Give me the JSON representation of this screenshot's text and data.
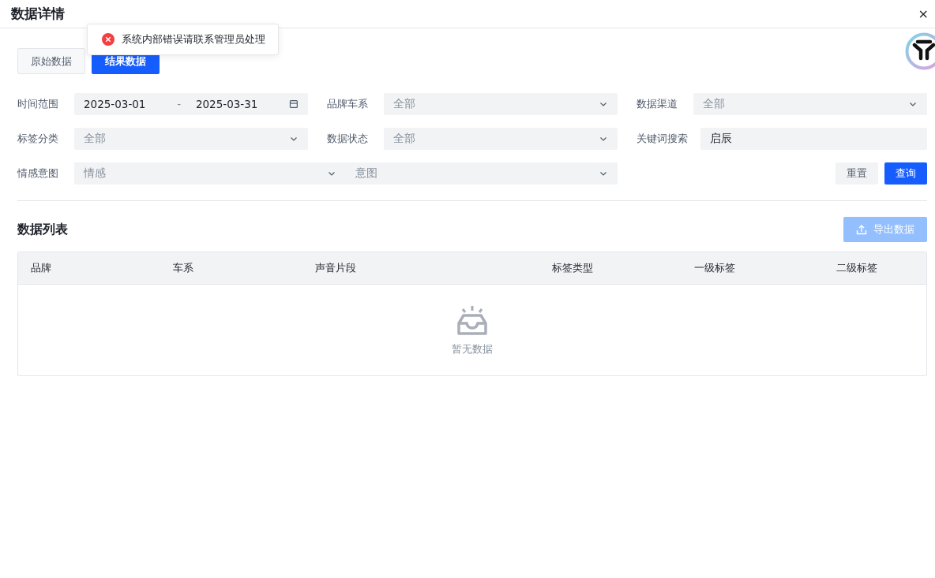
{
  "dialog": {
    "title": "数据详情",
    "close": "×"
  },
  "toast": {
    "kind": "error",
    "message": "系统内部错误请联系管理员处理"
  },
  "tabs": [
    {
      "label": "原始数据",
      "selected": false
    },
    {
      "label": "结果数据",
      "selected": true
    }
  ],
  "filters": [
    {
      "kind": "daterange",
      "label": "时间范围",
      "start": "2025-03-01",
      "separator": "-",
      "end": "2025-03-31"
    },
    {
      "kind": "select",
      "label": "品牌车系",
      "placeholder": "全部"
    },
    {
      "kind": "select",
      "label": "数据渠道",
      "placeholder": "全部"
    },
    {
      "kind": "select",
      "label": "标签分类",
      "placeholder": "全部"
    },
    {
      "kind": "select",
      "label": "数据状态",
      "placeholder": "全部"
    },
    {
      "kind": "text",
      "label": "关键词搜索",
      "value": "启辰"
    },
    {
      "kind": "dual-select",
      "label": "情感意图",
      "options": [
        {
          "placeholder": "情感"
        },
        {
          "placeholder": "意图"
        }
      ]
    }
  ],
  "actions": [
    {
      "label": "重置",
      "kind": "secondary"
    },
    {
      "label": "查询",
      "kind": "primary"
    }
  ],
  "list": {
    "title": "数据列表",
    "export": {
      "label": "导出数据",
      "disabled": true
    },
    "columns": [
      "品牌",
      "车系",
      "声音片段",
      "标签类型",
      "一级标签",
      "二级标签"
    ],
    "empty": "暂无数据"
  }
}
